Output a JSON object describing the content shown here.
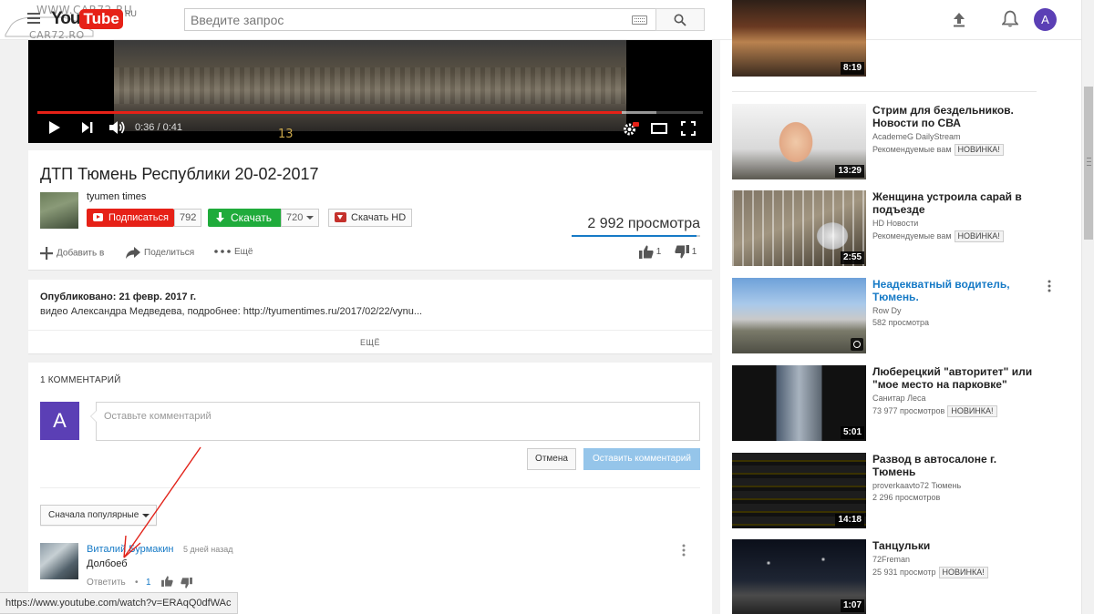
{
  "watermark": {
    "line1": "WWW.CAR72.RU",
    "line2": "CAR72.RO"
  },
  "masthead": {
    "logo_you": "You",
    "logo_tube": "Tube",
    "logo_sup": "RU",
    "search_placeholder": "Введите запрос",
    "avatar_letter": "A"
  },
  "player": {
    "time": "0:36 / 0:41",
    "progress": 0.878,
    "buffered_from": 0.86,
    "buffered_to": 0.93,
    "frame_text": "13"
  },
  "video": {
    "title": "ДТП Тюмень Республики 20-02-2017",
    "channel": "tyumen times",
    "subscribe_label": "Подписаться",
    "subscriber_count": "792",
    "download_label": "Скачать",
    "download_count": "720",
    "download_hd_label": "Скачать HD",
    "views": "2 992 просмотра",
    "like_ratio": 0.97,
    "add_label": "Добавить в",
    "share_label": "Поделиться",
    "more_label": "Ещё",
    "likes": "1",
    "dislikes": "1"
  },
  "description": {
    "published": "Опубликовано: 21 февр. 2017 г.",
    "text": "видео Александра Медведева, подробнее: http://tyumentimes.ru/2017/02/22/vynu...",
    "show_more": "ЕЩЁ"
  },
  "comments": {
    "count_label": "1 КОММЕНТАРИЙ",
    "avatar_letter": "A",
    "input_placeholder": "Оставьте комментарий",
    "cancel_label": "Отмена",
    "post_label": "Оставить комментарий",
    "sort_label": "Сначала популярные",
    "items": [
      {
        "author": "Виталий Бурмакин",
        "time": "5 дней назад",
        "text": "Долбоеб",
        "reply_label": "Ответить",
        "separator": "•",
        "likes": "1"
      }
    ]
  },
  "sidebar": {
    "items": [
      {
        "title": "",
        "channel": "",
        "meta": "",
        "duration": "8:19"
      },
      {
        "title": "Стрим для бездельников. Новости по СВА",
        "channel": "AcademeG DailyStream",
        "meta": "Рекомендуемые вам",
        "badge": "НОВИНКА!",
        "duration": "13:29"
      },
      {
        "title": "Женщина устроила сарай в подъезде",
        "channel": "HD Новости",
        "meta": "Рекомендуемые вам",
        "badge": "НОВИНКА!",
        "duration": "2:55"
      },
      {
        "title": "Неадекватный водитель, Тюмень.",
        "channel": "Row Dy",
        "meta": "582 просмотра",
        "duration": ""
      },
      {
        "title": "Люберецкий \"авторитет\" или \"мое место на парковке\"",
        "channel": "Санитар Леса",
        "meta": "73 977 просмотров",
        "badge": "НОВИНКА!",
        "duration": "5:01"
      },
      {
        "title": "Развод в автосалоне г. Тюмень",
        "channel": "proverkaavto72 Тюмень",
        "meta": "2 296 просмотров",
        "duration": "14:18"
      },
      {
        "title": "Танцульки",
        "channel": "72Freman",
        "meta": "25 931 просмотр",
        "badge": "НОВИНКА!",
        "duration": "1:07"
      }
    ]
  },
  "status_bar": {
    "url": "https://www.youtube.com/watch?v=ERAqQ0dfWAc"
  },
  "colors": {
    "brand_red": "#e62117",
    "link_blue": "#167ac6",
    "download_green": "#1fab3b",
    "avatar_purple": "#5b3fb5"
  }
}
